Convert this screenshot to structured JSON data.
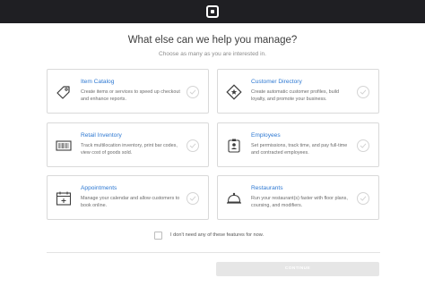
{
  "header": {
    "logo": "square-logo"
  },
  "main": {
    "title": "What else can we help you manage?",
    "subtitle": "Choose as many as you are interested in."
  },
  "cards": [
    {
      "title": "Item Catalog",
      "description": "Create items or services to speed up checkout and enhance reports.",
      "icon": "tag-icon"
    },
    {
      "title": "Customer Directory",
      "description": "Create automatic customer profiles, build loyalty, and promote your business.",
      "icon": "star-badge-icon"
    },
    {
      "title": "Retail Inventory",
      "description": "Track multilocation inventory, print bar codes, view cost of goods sold.",
      "icon": "barcode-icon"
    },
    {
      "title": "Employees",
      "description": "Set permissions, track time, and pay full-time and contracted employees.",
      "icon": "employee-badge-icon"
    },
    {
      "title": "Appointments",
      "description": "Manage your calendar and allow customers to book online.",
      "icon": "calendar-icon"
    },
    {
      "title": "Restaurants",
      "description": "Run your restaurant(s) faster with floor plans, coursing, and modifiers.",
      "icon": "cloche-icon"
    }
  ],
  "none_option": {
    "label": "I don't need any of these features for now."
  },
  "footer": {
    "continue_label": "CONTINUE"
  },
  "colors": {
    "accent": "#2d78d2",
    "topbar": "#1f1f23",
    "border": "#d9d9d9",
    "disabled_button": "#e6e6e6"
  }
}
